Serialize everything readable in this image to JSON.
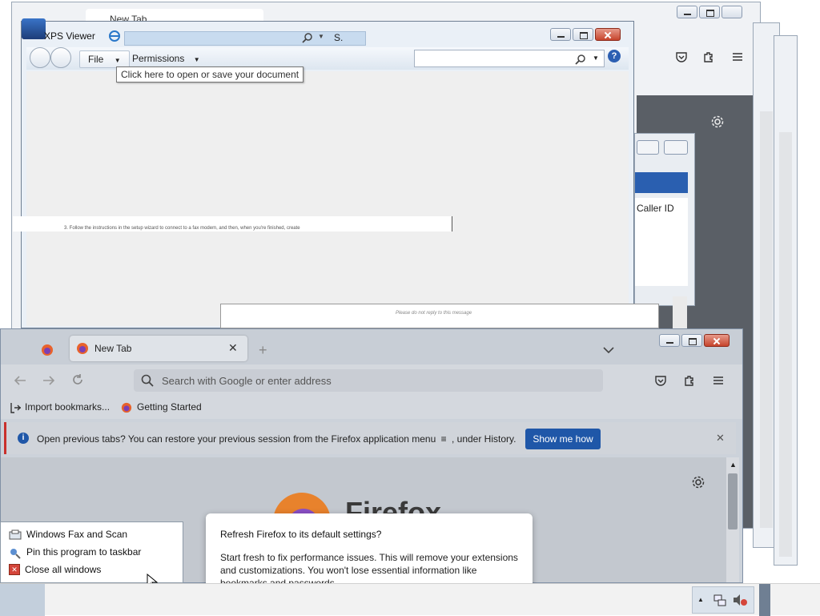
{
  "background_windows": {
    "top_tab_label": "New Tab",
    "caller_id_column": "Caller ID",
    "doc_line": "3.    Follow the instructions in the setup wizard to connect to a fax modem, and then, when you're finished, create",
    "email_footer": "Please do not reply to this message"
  },
  "xps": {
    "title": "XPS Viewer",
    "address_suffix": "S.",
    "file_menu": "File",
    "permissions_menu": "Permissions",
    "tooltip": "Click here to open or save your document"
  },
  "firefox": {
    "tab_label": "New Tab",
    "url_placeholder": "Search with Google or enter address",
    "bookmarks": {
      "import": "Import bookmarks...",
      "getting_started": "Getting Started"
    },
    "notification": {
      "text": "Open previous tabs? You can restore your previous session from the Firefox application menu",
      "menu_symbol": "≡",
      "text_suffix": ", under History.",
      "button": "Show me how"
    },
    "logo_word": "Firefox"
  },
  "refresh_dialog": {
    "title": "Refresh Firefox to its default settings?",
    "body": "Start fresh to fix performance issues. This will remove your extensions and customizations. You won't lose essential information like bookmarks and passwords."
  },
  "jump_list": {
    "app": "Windows Fax and Scan",
    "pin": "Pin this program to taskbar",
    "close": "Close all windows"
  },
  "colors": {
    "accent_blue": "#1f57a8",
    "notification_red": "#c9302c",
    "xps_frame": "#eaf0f7"
  }
}
